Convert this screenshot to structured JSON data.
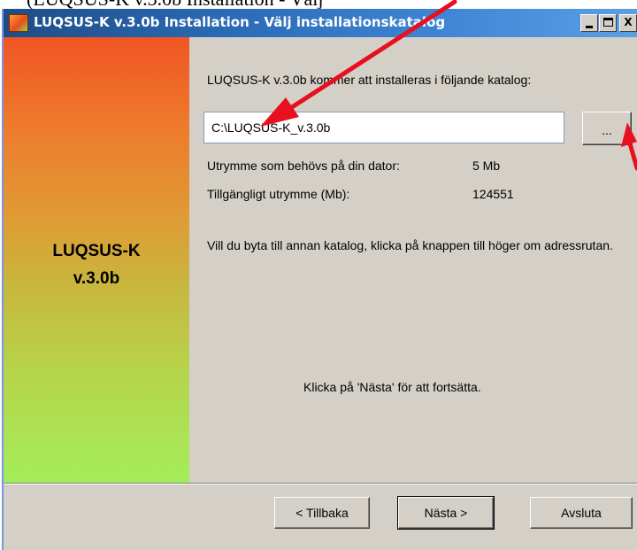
{
  "top_crop": {
    "text": "(LUQSUS-K v.3.0b Installation - Välj"
  },
  "window": {
    "title": "LUQSUS-K v.3.0b Installation - Välj installationskatalog",
    "icon": "app-installer-icon",
    "controls": {
      "minimize": "minimize-icon",
      "maximize": "maximize-icon",
      "close": "X"
    }
  },
  "side_panel": {
    "title_line1": "LUQSUS-K",
    "title_line2": "v.3.0b",
    "gradient_top": "#f05523",
    "gradient_bottom": "#a4ed5a"
  },
  "content": {
    "intro": "LUQSUS-K v.3.0b kommer att installeras i följande katalog:",
    "path_value": "C:\\LUQSUS-K_v.3.0b",
    "browse_label": "...",
    "space_needed_label": "Utrymme som behövs på din dator:",
    "space_needed_value": "5 Mb",
    "space_available_label": "Tillgängligt utrymme (Mb):",
    "space_available_value": "124551",
    "change_dir_text": "Vill du byta till annan katalog, klicka på knappen till höger om adressrutan.",
    "continue_text": "Klicka på 'Nästa' för att fortsätta."
  },
  "buttons": {
    "back": "< Tillbaka",
    "next": "Nästa >",
    "cancel": "Avsluta"
  },
  "annotation_color": "#e8101e"
}
